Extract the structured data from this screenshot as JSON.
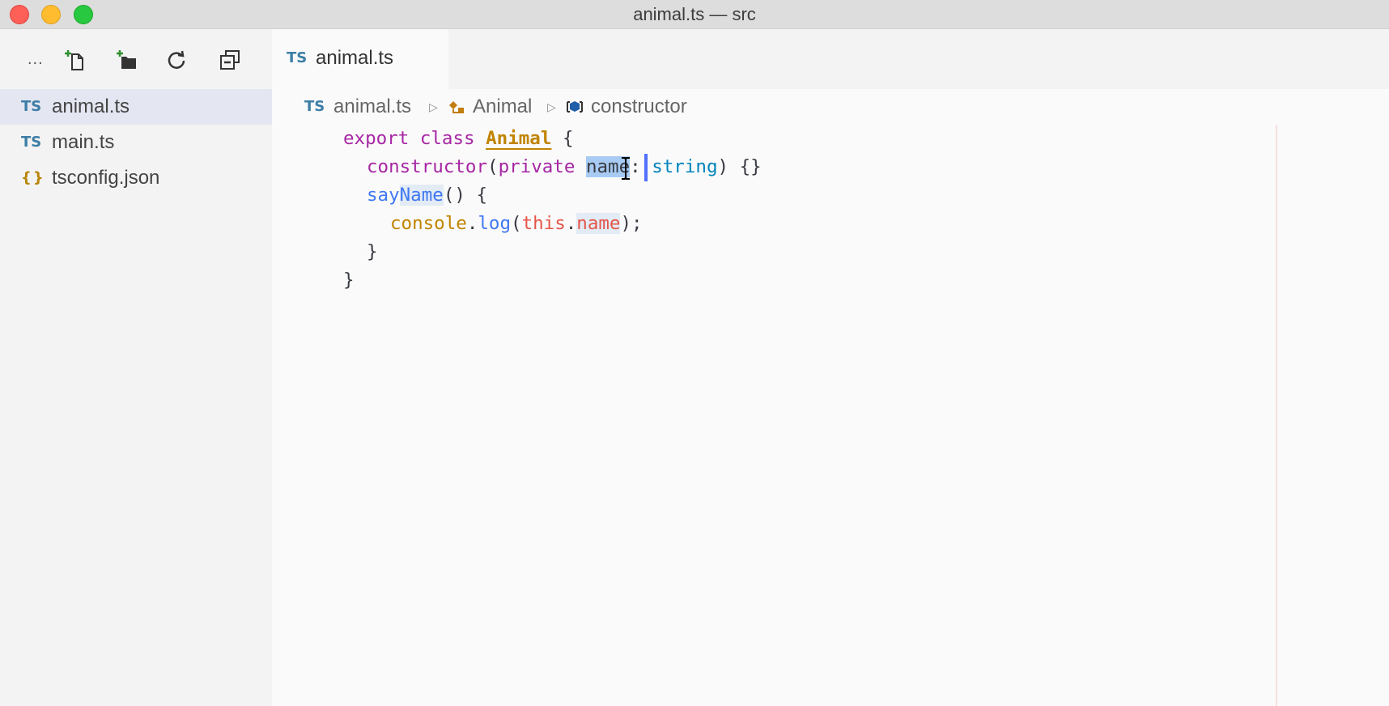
{
  "window": {
    "title": "animal.ts — src"
  },
  "sidebar": {
    "toolbar": {
      "more_label": "...",
      "icons": [
        "new-file-icon",
        "new-folder-icon",
        "refresh-icon",
        "collapse-all-icon"
      ]
    },
    "files": [
      {
        "icon": "TS",
        "label": "animal.ts",
        "active": true
      },
      {
        "icon": "TS",
        "label": "main.ts",
        "active": false
      },
      {
        "icon": "{}",
        "label": "tsconfig.json",
        "active": false
      }
    ]
  },
  "editor": {
    "tab": {
      "icon": "TS",
      "label": "animal.ts"
    },
    "breadcrumbs": [
      {
        "icon": "TS",
        "label": "animal.ts"
      },
      {
        "icon": "class-icon",
        "label": "Animal"
      },
      {
        "icon": "method-icon",
        "label": "constructor"
      }
    ],
    "code": {
      "l1_kw1": "export",
      "l1_kw2": "class",
      "l1_cls": "Animal",
      "l1_brace": "{",
      "l2_fn": "constructor",
      "l2_paren": "(",
      "l2_kw": "private",
      "l2_name_a": "na",
      "l2_name_b": "me",
      "l2_colon": ":",
      "l2_type": "string",
      "l2_end": ") {}",
      "l3_fn_a": "say",
      "l3_fn_b": "Name",
      "l3_end": "() {",
      "l4_obj": "console",
      "l4_dot": ".",
      "l4_fn": "log",
      "l4_paren": "(",
      "l4_this": "this",
      "l4_dot2": ".",
      "l4_prop": "name",
      "l4_end": ");",
      "l5": "}",
      "l6": "}"
    }
  }
}
